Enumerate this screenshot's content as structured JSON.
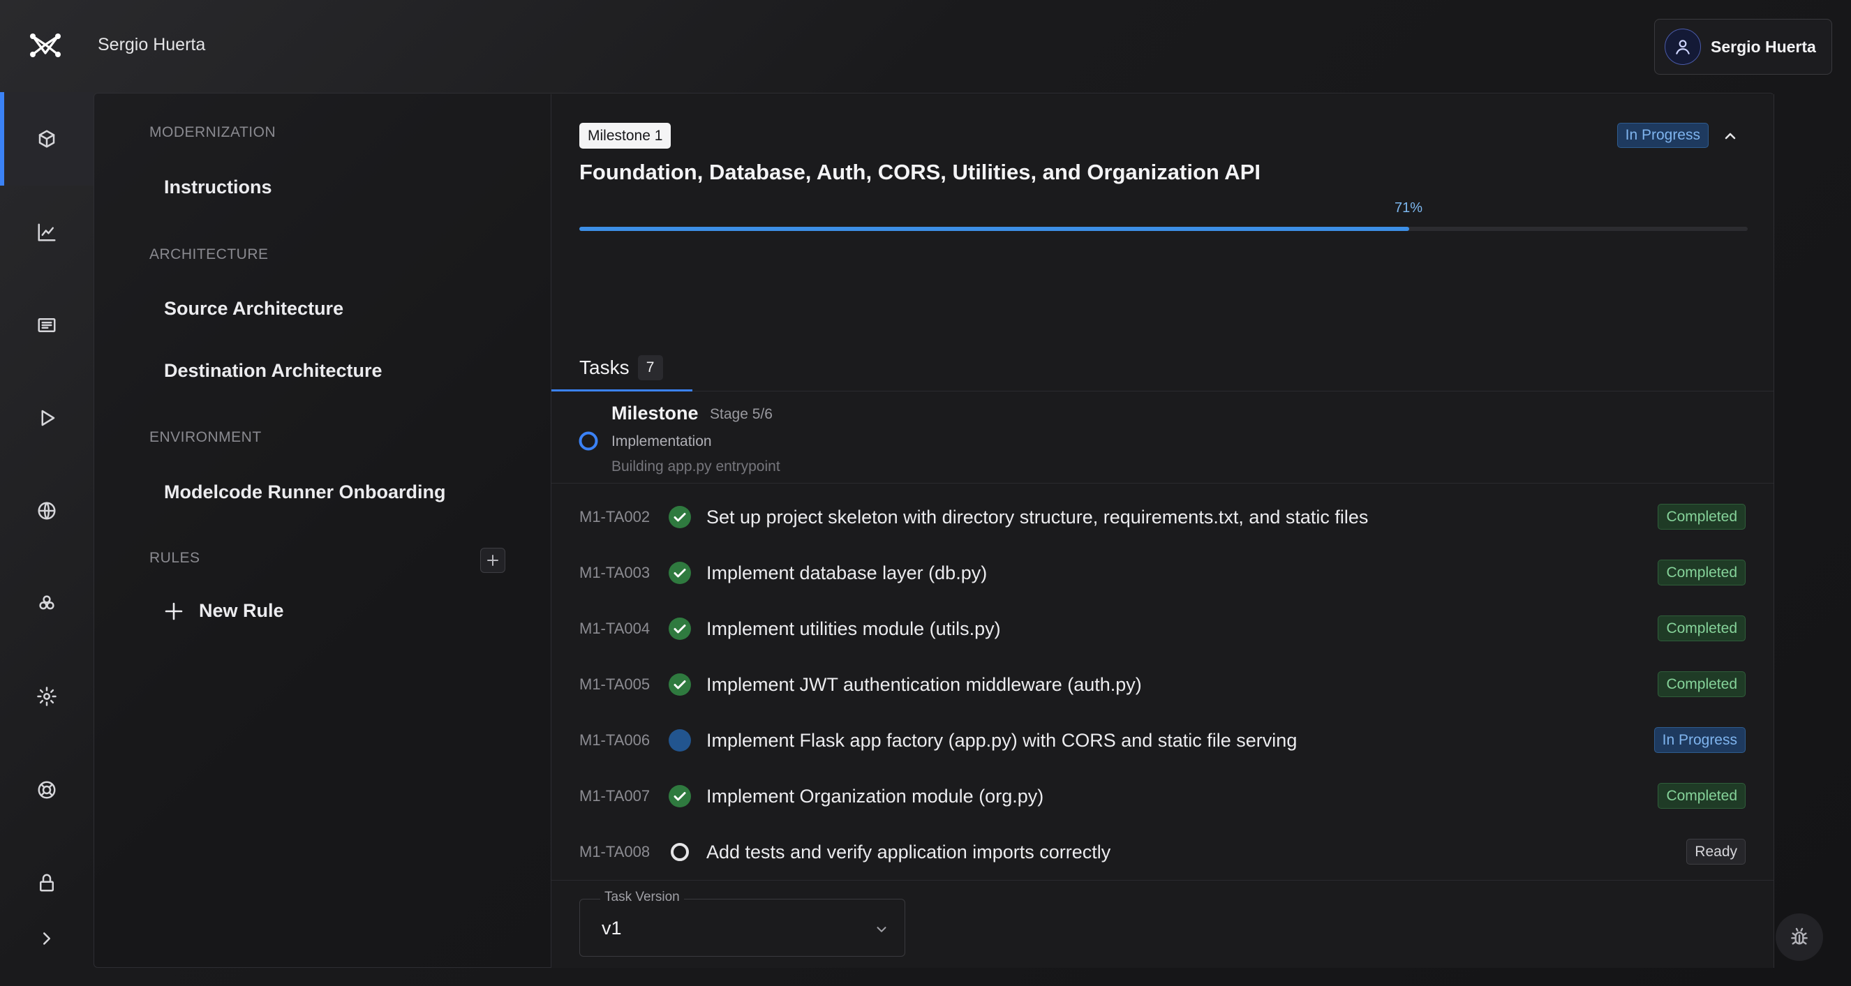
{
  "header": {
    "workspace_name": "Sergio Huerta",
    "user_name": "Sergio Huerta"
  },
  "rail": {
    "items": [
      "cube-icon",
      "chart-line-icon",
      "newspaper-icon",
      "play-icon",
      "globe-icon",
      "users-icon",
      "gear-icon",
      "lifebuoy-icon",
      "lock-icon",
      "chevron-right-icon"
    ],
    "active_index": 0
  },
  "nav": {
    "sections": [
      {
        "label": "MODERNIZATION",
        "items": [
          "Instructions"
        ]
      },
      {
        "label": "ARCHITECTURE",
        "items": [
          "Source Architecture",
          "Destination Architecture"
        ]
      },
      {
        "label": "ENVIRONMENT",
        "items": [
          "Modelcode Runner Onboarding"
        ]
      },
      {
        "label": "RULES",
        "items": [
          "New Rule"
        ]
      }
    ]
  },
  "milestone": {
    "chip": "Milestone 1",
    "status": "In Progress",
    "title": "Foundation, Database, Auth, CORS, Utilities, and Organization API",
    "progress_label": "71%",
    "progress": 0.71
  },
  "tabs": {
    "tasks_label": "Tasks",
    "tasks_count": "7"
  },
  "stage": {
    "title": "Milestone",
    "stage": "Stage 5/6",
    "phase": "Implementation",
    "detail": "Building app.py entrypoint"
  },
  "tasks": [
    {
      "id": "M1-TA002",
      "title": "Set up project skeleton with directory structure, requirements.txt, and static files",
      "status": "Completed"
    },
    {
      "id": "M1-TA003",
      "title": "Implement database layer (db.py)",
      "status": "Completed"
    },
    {
      "id": "M1-TA004",
      "title": "Implement utilities module (utils.py)",
      "status": "Completed"
    },
    {
      "id": "M1-TA005",
      "title": "Implement JWT authentication middleware (auth.py)",
      "status": "Completed"
    },
    {
      "id": "M1-TA006",
      "title": "Implement Flask app factory (app.py) with CORS and static file serving",
      "status": "In Progress"
    },
    {
      "id": "M1-TA007",
      "title": "Implement Organization module (org.py)",
      "status": "Completed"
    },
    {
      "id": "M1-TA008",
      "title": "Add tests and verify application imports correctly",
      "status": "Ready"
    }
  ],
  "version": {
    "label": "Task Version",
    "value": "v1"
  },
  "colors": {
    "accent": "#3b82f6",
    "completed": "#86d39a",
    "in_progress": "#7fb4ee"
  }
}
